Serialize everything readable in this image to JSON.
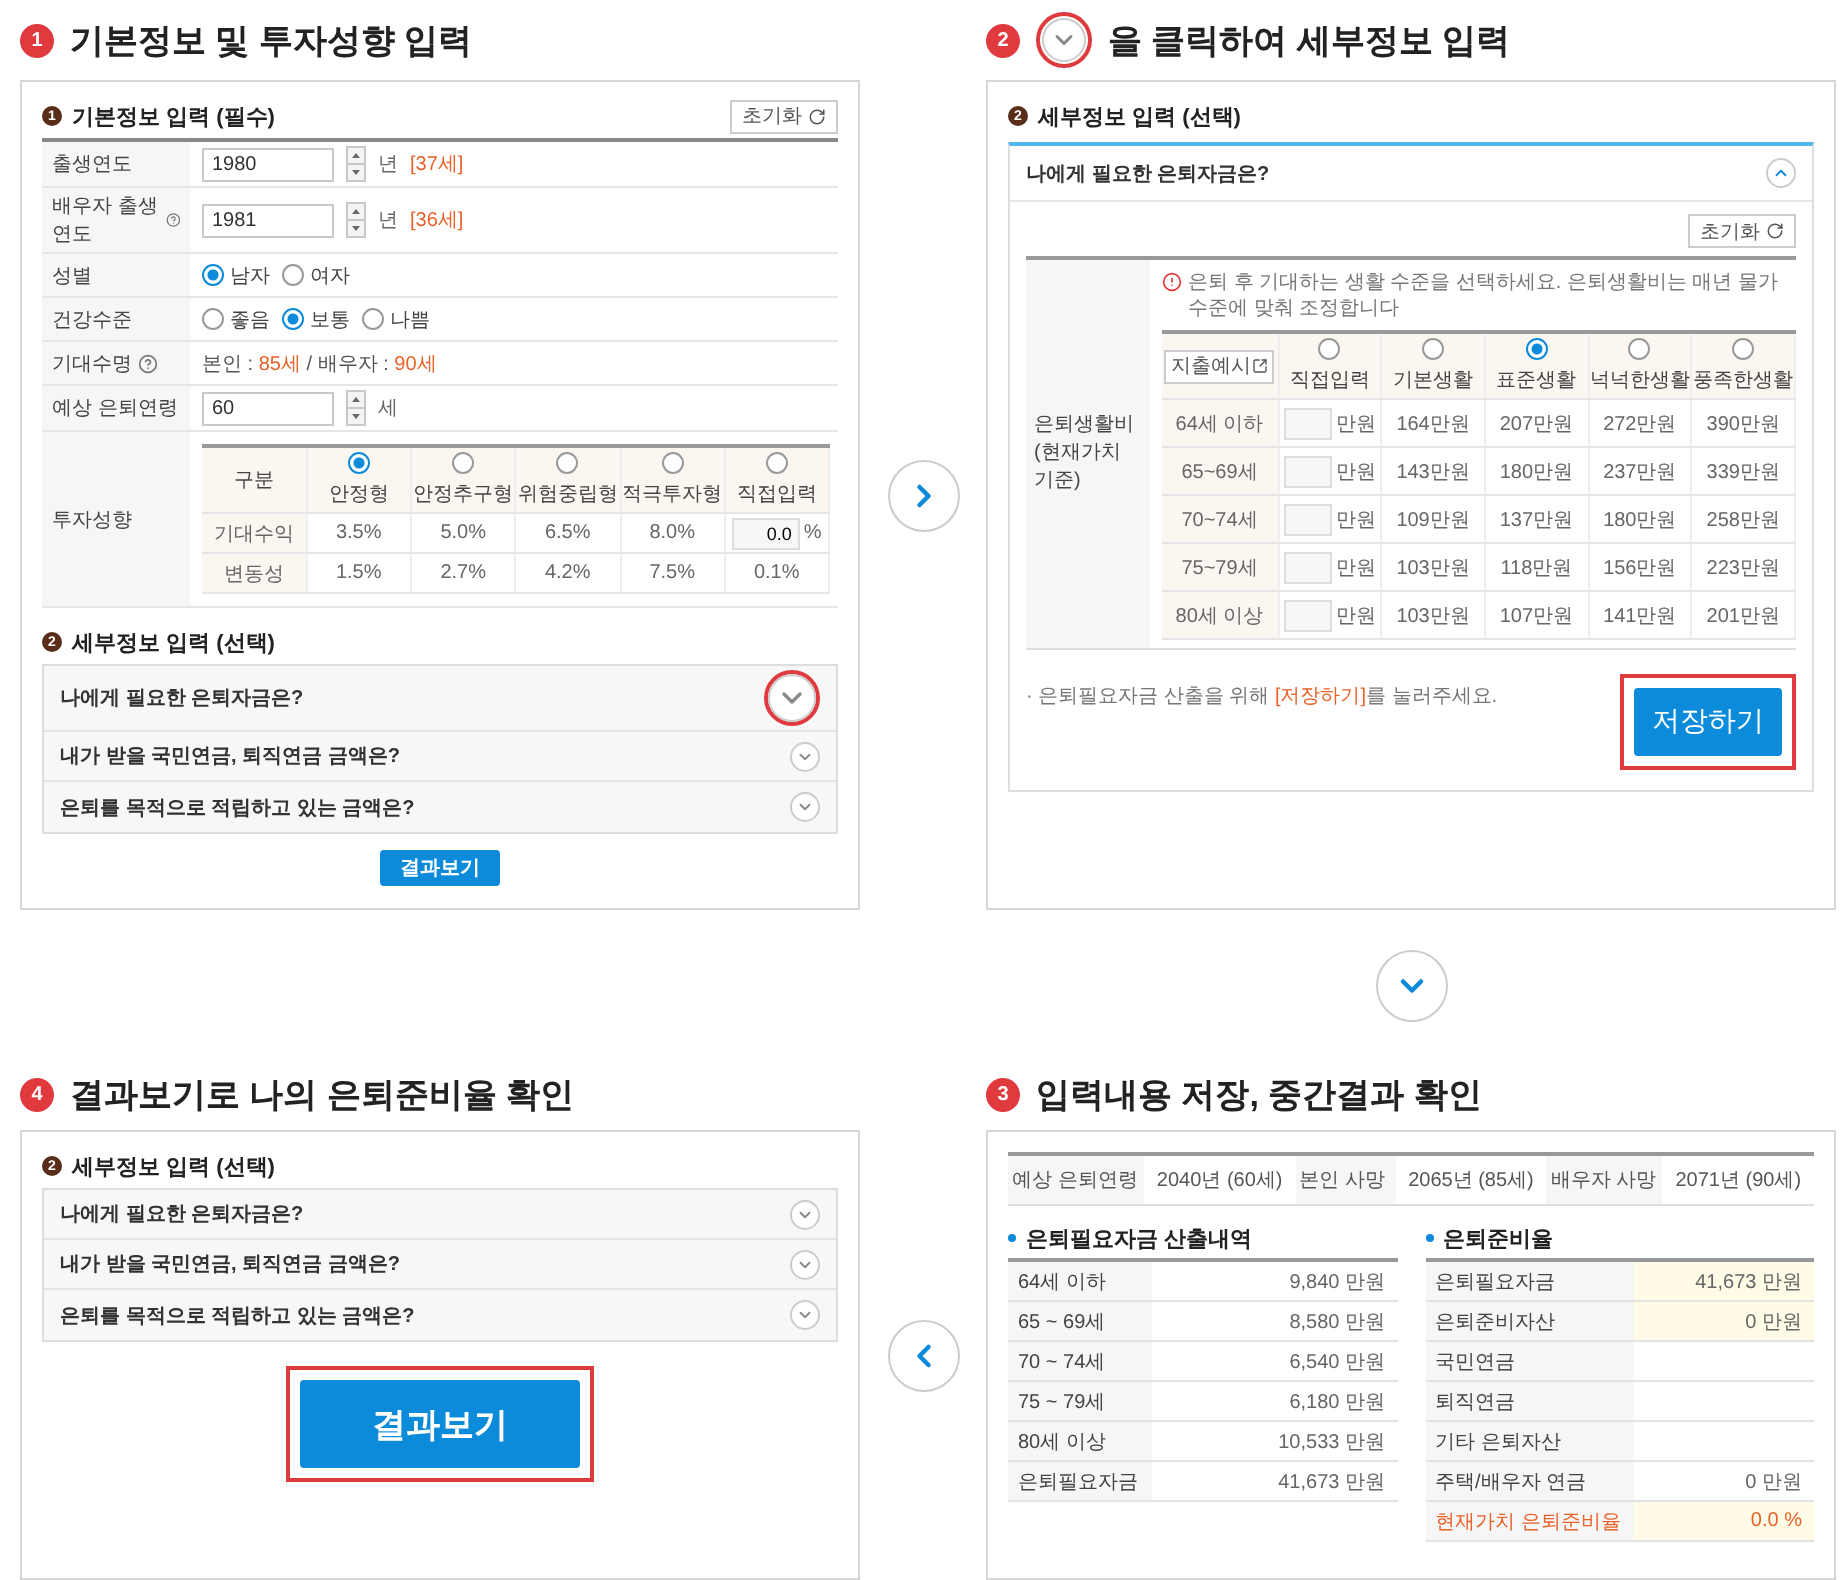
{
  "step_1": {
    "number": "1",
    "title": "기본정보 및 투자성향 입력",
    "basic": {
      "marker": "1",
      "title": "기본정보 입력 (필수)",
      "reset": "초기화"
    },
    "fields": [
      {
        "kind": "number",
        "label": "출생연도",
        "help": false,
        "value": "1980",
        "unit": "년",
        "note": "[37세]"
      },
      {
        "kind": "number",
        "label": "배우자 출생연도",
        "help": true,
        "value": "1981",
        "unit": "년",
        "note": "[36세]"
      },
      {
        "kind": "radio",
        "label": "성별",
        "help": false,
        "options": [
          {
            "label": "남자",
            "selected": true
          },
          {
            "label": "여자",
            "selected": false
          }
        ]
      },
      {
        "kind": "radio",
        "label": "건강수준",
        "help": false,
        "options": [
          {
            "label": "좋음",
            "selected": false
          },
          {
            "label": "보통",
            "selected": true
          },
          {
            "label": "나쁨",
            "selected": false
          }
        ]
      },
      {
        "kind": "text",
        "label": "기대수명",
        "help": true,
        "parts": [
          {
            "text": "본인 : ",
            "accent": false
          },
          {
            "text": "85세",
            "accent": true
          },
          {
            "text": " / 배우자 : ",
            "accent": false
          },
          {
            "text": "90세",
            "accent": true
          }
        ]
      },
      {
        "kind": "number",
        "label": "예상 은퇴연령",
        "help": false,
        "value": "60",
        "unit": "세"
      },
      {
        "kind": "table",
        "label": "투자성향",
        "help": false,
        "corner": "구분",
        "options": [
          {
            "label": "안정형",
            "selected": true
          },
          {
            "label": "안정추구형",
            "selected": false
          },
          {
            "label": "위험중립형",
            "selected": false
          },
          {
            "label": "적극투자형",
            "selected": false
          },
          {
            "label": "직접입력",
            "selected": false
          }
        ],
        "rows": [
          {
            "label": "기대수익",
            "cells": [
              {
                "kind": "text",
                "text": "3.5%"
              },
              {
                "kind": "text",
                "text": "5.0%"
              },
              {
                "kind": "text",
                "text": "6.5%"
              },
              {
                "kind": "text",
                "text": "8.0%"
              },
              {
                "kind": "input",
                "value": "0.0",
                "unit": "%"
              }
            ]
          },
          {
            "label": "변동성",
            "cells": [
              {
                "kind": "text",
                "text": "1.5%"
              },
              {
                "kind": "text",
                "text": "2.7%"
              },
              {
                "kind": "text",
                "text": "4.2%"
              },
              {
                "kind": "text",
                "text": "7.5%"
              },
              {
                "kind": "text",
                "text": "0.1%"
              }
            ]
          }
        ]
      }
    ],
    "detail": {
      "marker": "2",
      "title": "세부정보 입력 (선택)",
      "items": [
        {
          "label": "나에게 필요한 은퇴자금은?",
          "highlighted": true
        },
        {
          "label": "내가 받을 국민연금, 퇴직연금 금액은?",
          "highlighted": false
        },
        {
          "label": "은퇴를 목적으로 적립하고 있는 금액은?",
          "highlighted": false
        }
      ]
    },
    "result_button": {
      "label": "결과보기",
      "highlighted": false
    }
  },
  "step_2": {
    "number": "2",
    "title": "을 클릭하여 세부정보 입력",
    "section": {
      "marker": "2",
      "title": "세부정보 입력 (선택)"
    },
    "accordion": {
      "label": "나에게 필요한 은퇴자금은?",
      "expanded": true
    },
    "reset": "초기화",
    "row_label": "은퇴생활비 (현재가치 기준)",
    "hint": "은퇴 후 기대하는 생활 수준을 선택하세요. 은퇴생활비는 매년 물가수준에 맞춰 조정합니다",
    "example_button": "지출예시",
    "levels": [
      {
        "label": "직접입력",
        "selected": false
      },
      {
        "label": "기본생활",
        "selected": false
      },
      {
        "label": "표준생활",
        "selected": true
      },
      {
        "label": "넉넉한생활",
        "selected": false
      },
      {
        "label": "풍족한생활",
        "selected": false
      }
    ],
    "rows": [
      {
        "age": "64세 이하",
        "unit": "만원",
        "values": [
          "164만원",
          "207만원",
          "272만원",
          "390만원"
        ]
      },
      {
        "age": "65~69세",
        "unit": "만원",
        "values": [
          "143만원",
          "180만원",
          "237만원",
          "339만원"
        ]
      },
      {
        "age": "70~74세",
        "unit": "만원",
        "values": [
          "109만원",
          "137만원",
          "180만원",
          "258만원"
        ]
      },
      {
        "age": "75~79세",
        "unit": "만원",
        "values": [
          "103만원",
          "118만원",
          "156만원",
          "223만원"
        ]
      },
      {
        "age": "80세 이상",
        "unit": "만원",
        "values": [
          "103만원",
          "107만원",
          "141만원",
          "201만원"
        ]
      }
    ],
    "note": [
      {
        "text": "· 은퇴필요자금 산출을 위해 ",
        "accent": false
      },
      {
        "text": "[저장하기]",
        "accent": true
      },
      {
        "text": "를 눌러주세요.",
        "accent": false
      }
    ],
    "save_button": {
      "label": "저장하기",
      "highlighted": true
    }
  },
  "step_3": {
    "number": "3",
    "title": "입력내용 저장, 중간결과 확인",
    "summary": [
      {
        "label": "예상 은퇴연령",
        "value": "2040년 (60세)"
      },
      {
        "label": "본인 사망",
        "value": "2065년 (85세)"
      },
      {
        "label": "배우자 사망",
        "value": "2071년 (90세)"
      }
    ],
    "need": {
      "title": "은퇴필요자금 산출내역",
      "rows": [
        {
          "label": "64세 이하",
          "value": "9,840 만원"
        },
        {
          "label": "65 ~ 69세",
          "value": "8,580 만원"
        },
        {
          "label": "70 ~ 74세",
          "value": "6,540 만원"
        },
        {
          "label": "75 ~ 79세",
          "value": "6,180 만원"
        },
        {
          "label": "80세 이상",
          "value": "10,533 만원"
        },
        {
          "label": "은퇴필요자금",
          "value": "41,673 만원"
        }
      ]
    },
    "ratio": {
      "title": "은퇴준비율",
      "rows": [
        {
          "label": "은퇴필요자금",
          "value": "41,673 만원",
          "highlighted": true,
          "emphasis": false
        },
        {
          "label": "은퇴준비자산",
          "value": "0 만원",
          "highlighted": true,
          "emphasis": false
        },
        {
          "label": "국민연금",
          "highlighted": false,
          "emphasis": false
        },
        {
          "label": "퇴직연금",
          "highlighted": false,
          "emphasis": false
        },
        {
          "label": "기타 은퇴자산",
          "highlighted": false,
          "emphasis": false
        },
        {
          "label": "주택/배우자 연금",
          "value": "0 만원",
          "highlighted": false,
          "emphasis": false
        },
        {
          "label": "현재가치 은퇴준비율",
          "value": "0.0 %",
          "highlighted": true,
          "emphasis": true
        }
      ]
    }
  },
  "step_4": {
    "number": "4",
    "title": "결과보기로 나의 은퇴준비율 확인",
    "detail": {
      "marker": "2",
      "title": "세부정보 입력 (선택)",
      "items": [
        {
          "label": "나에게 필요한 은퇴자금은?",
          "highlighted": false
        },
        {
          "label": "내가 받을 국민연금, 퇴직연금 금액은?",
          "highlighted": false
        },
        {
          "label": "은퇴를 목적으로 적립하고 있는 금액은?",
          "highlighted": false
        }
      ]
    },
    "result_button": {
      "label": "결과보기",
      "highlighted": true
    }
  }
}
